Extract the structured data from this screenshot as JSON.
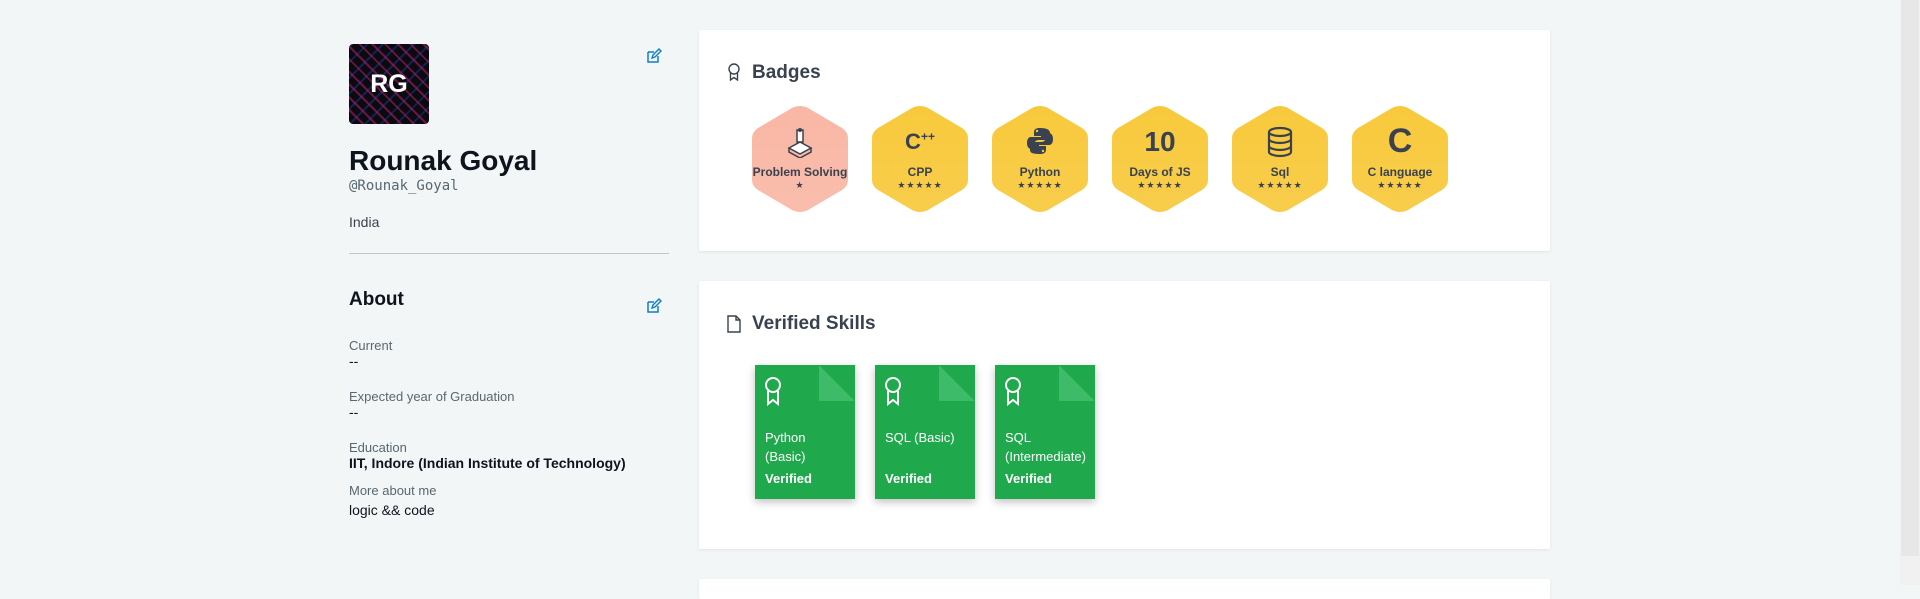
{
  "profile": {
    "initials": "RG",
    "name": "Rounak Goyal",
    "handle": "@Rounak_Goyal",
    "country": "India"
  },
  "about": {
    "title": "About",
    "current_label": "Current",
    "current_value": "--",
    "graduation_label": "Expected year of Graduation",
    "graduation_value": "--",
    "education_label": "Education",
    "education_value": "IIT, Indore (Indian Institute of Technology)",
    "more_label": "More about me",
    "more_value": "logic && code"
  },
  "badges": {
    "title": "Badges",
    "items": [
      {
        "icon_text": "",
        "icon": "problem-solving-icon",
        "label": "Problem Solving",
        "stars": "★",
        "stars_count": 1,
        "color": "#f9b7a5"
      },
      {
        "icon_text": "C++",
        "icon": "cpp-icon",
        "label": "CPP",
        "stars": "★★★★★",
        "stars_count": 5,
        "color": "#f8c93c"
      },
      {
        "icon_text": "",
        "icon": "python-icon",
        "label": "Python",
        "stars": "★★★★★",
        "stars_count": 5,
        "color": "#f8c93c"
      },
      {
        "icon_text": "10",
        "icon": "days-of-js-icon",
        "label": "Days of JS",
        "stars": "★★★★★",
        "stars_count": 5,
        "color": "#f8c93c"
      },
      {
        "icon_text": "",
        "icon": "sql-database-icon",
        "label": "Sql",
        "stars": "★★★★★",
        "stars_count": 5,
        "color": "#f8c93c"
      },
      {
        "icon_text": "C",
        "icon": "c-language-icon",
        "label": "C language",
        "stars": "★★★★★",
        "stars_count": 5,
        "color": "#f8c93c"
      }
    ]
  },
  "skills": {
    "title": "Verified Skills",
    "items": [
      {
        "name": "Python (Basic)",
        "status": "Verified"
      },
      {
        "name": "SQL (Basic)",
        "status": "Verified"
      },
      {
        "name": "SQL (Intermediate)",
        "status": "Verified"
      }
    ]
  },
  "colors": {
    "background": "#f3f6f7",
    "accent": "#1ba94c",
    "edit_icon": "#0f7ec9",
    "badge_gold": "#f8c93c",
    "badge_salmon": "#f9b7a5"
  }
}
